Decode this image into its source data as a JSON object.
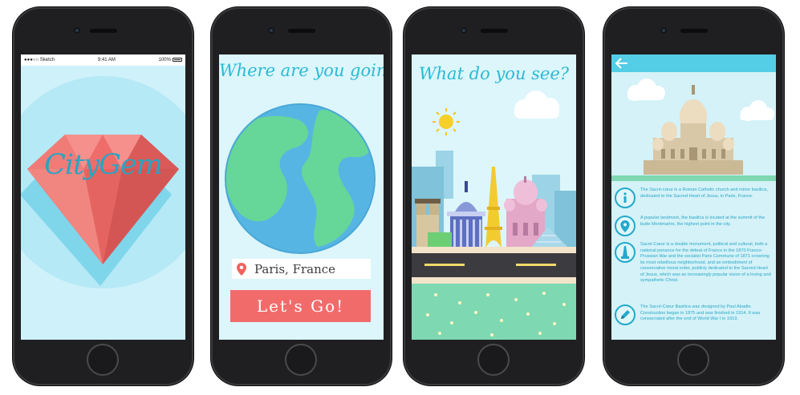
{
  "colors": {
    "accent_blue": "#2cb9d6",
    "button_red": "#f26b6b",
    "screen_bg": "#dcf6fb",
    "ground_green": "#7ed8b2"
  },
  "splash": {
    "status": {
      "carrier": "●●●○○ Sketch",
      "time": "9:41 AM",
      "battery": "100%"
    },
    "logo": "CityGem"
  },
  "destination": {
    "title": "Where are you going?",
    "location_value": "Paris, France",
    "location_icon": "map-pin-icon",
    "button_label": "Let's Go!"
  },
  "discover": {
    "title": "What do you see?"
  },
  "detail": {
    "back_icon": "back-arrow-icon",
    "items": [
      {
        "icon": "info-icon",
        "text": "The Sacré-cœur is a Roman Catholic church and minor basilica, dedicated to the Sacred Heart of Jesus, in Paris, France."
      },
      {
        "icon": "location-pin-icon",
        "text": "A popular landmark, the basilica is located at the summit of the butte Montmartre, the highest point in the city."
      },
      {
        "icon": "monument-icon",
        "text": "Sacré-Cœur is a double monument, political and cultural, both a national penance for the defeat of France in the 1870 Franco-Prussian War and the socialist Paris Commune of 1871 crowning its most rebellious neighborhood, and an embodiment of conservative moral order, publicly dedicated to the Sacred Heart of Jesus, which was an increasingly popular vision of a loving and sympathetic Christ."
      },
      {
        "icon": "pencil-icon",
        "text": "The Sacré-Cœur Basilica was designed by Paul Abadie. Construction began in 1875 and was finished in 1914. It was consecrated after the end of World War I in 1919."
      }
    ]
  }
}
